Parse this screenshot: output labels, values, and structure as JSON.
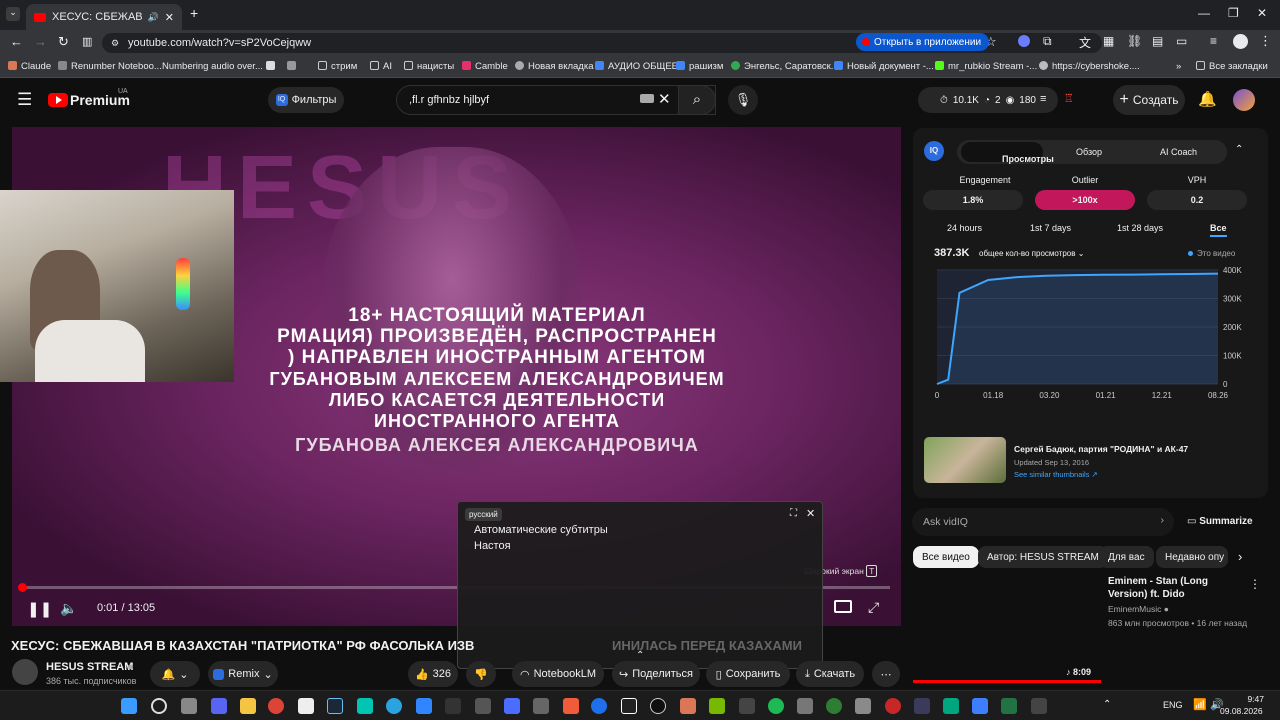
{
  "browser": {
    "tab_title": "ХЕСУС: СБЕЖАВШАЯ В КАЗ...",
    "url": "youtube.com/watch?v=sP2VoCejqww",
    "open_in_app": "Открыть в приложении",
    "bookmarks": [
      "Claude",
      "Renumber Noteboo...",
      "Numbering audio over...",
      "стрим",
      "AI",
      "нацисты",
      "Camble",
      "Новая вкладка",
      "АУДИО ОБЩЕЕ",
      "рашизм",
      "Энгельс, Саратовск...",
      "Новый документ -...",
      "mr_rubkio Stream -...",
      "https://cybershoke...."
    ],
    "all_bookmarks": "Все закладки"
  },
  "header": {
    "logo": "Premium",
    "region": "UA",
    "filters": "Фильтры",
    "search_value": ",fl.r gfhnbz hjlbyf",
    "stats": {
      "views": "10.1K",
      "comments": "2",
      "watching": "180"
    },
    "create": "Создать"
  },
  "player": {
    "bg_title": "HESUS",
    "disclaimer": [
      "18+ НАСТОЯЩИЙ МАТЕРИАЛ",
      "РМАЦИЯ) ПРОИЗВЕДЁН, РАСПРОСТРАНЕН",
      ") НАПРАВЛЕН ИНОСТРАННЫМ АГЕНТОМ",
      "ГУБАНОВЫМ АЛЕКСЕЕМ АЛЕКСАНДРОВИЧЕМ",
      "ЛИБО КАСАЕТСЯ ДЕЯТЕЛЬНОСТИ",
      "ИНОСТРАННОГО АГЕНТА",
      "ГУБАНОВА АЛЕКСЕЯ АЛЕКСАНДРОВИЧА"
    ],
    "time": "0:01 / 13:05",
    "progress": 0.001,
    "wide_tooltip": "Широкий экран",
    "wide_key": "T"
  },
  "captions": {
    "lang": "русский",
    "line1": "Автоматические субтитры",
    "line2": "Настоя"
  },
  "video": {
    "title": "ХЕСУС: СБЕЖАВШАЯ В КАЗАХСТАН \"ПАТРИОТКА\" РФ ФАСОЛЬКА ИЗВ",
    "title_tail": "ИНИЛАСЬ ПЕРЕД КАЗАХАМИ",
    "channel": "HESUS STREAM",
    "subs": "386 тыс. подписчиков",
    "remix": "Remix",
    "likes": "326",
    "notebook": "NotebookLM",
    "share": "Поделиться",
    "save": "Сохранить",
    "download": "Скачать"
  },
  "vidiq": {
    "tabs": [
      "Просмотры",
      "Обзор",
      "AI Coach"
    ],
    "metrics": [
      {
        "label": "Engagement",
        "value": "1.8%"
      },
      {
        "label": "Outlier",
        "value": ">100x"
      },
      {
        "label": "VPH",
        "value": "0.2"
      }
    ],
    "ranges": [
      "24 hours",
      "1st 7 days",
      "1st 28 days",
      "Все"
    ],
    "total": "387.3K",
    "total_label": "общее кол-во просмотров",
    "legend": "Это видео",
    "similar_title": "Сергей Бадюк, партия \"РОДИНА\" и АК-47",
    "similar_updated": "Updated Sep 13, 2016",
    "similar_link": "See similar thumbnails",
    "ask": "Ask vidIQ",
    "summarize": "Summarize"
  },
  "chart_data": {
    "type": "line",
    "x": [
      "0",
      "01.18",
      "03.20",
      "01.21",
      "12.21",
      "08.26"
    ],
    "yticks": [
      "0",
      "100K",
      "200K",
      "300K",
      "400K"
    ],
    "series": [
      {
        "name": "Это видео",
        "values": [
          0,
          15000,
          320000,
          365000,
          375000,
          380000,
          382000,
          383000,
          384000,
          385000,
          386000,
          387300
        ]
      }
    ],
    "ylim": [
      0,
      400000
    ],
    "color": "#3ea6ff"
  },
  "chips": [
    "Все видео",
    "Автор: HESUS STREAM",
    "Для вас",
    "Недавно опу"
  ],
  "rec": {
    "title": "Eminem - Stan (Long Version) ft. Dido",
    "channel": "EminemMusic",
    "meta": "863 млн просмотров • 16 лет назад",
    "duration": "8:09"
  },
  "taskbar": {
    "lang": "ENG",
    "time": "9:47",
    "date": "09.08.2026"
  }
}
